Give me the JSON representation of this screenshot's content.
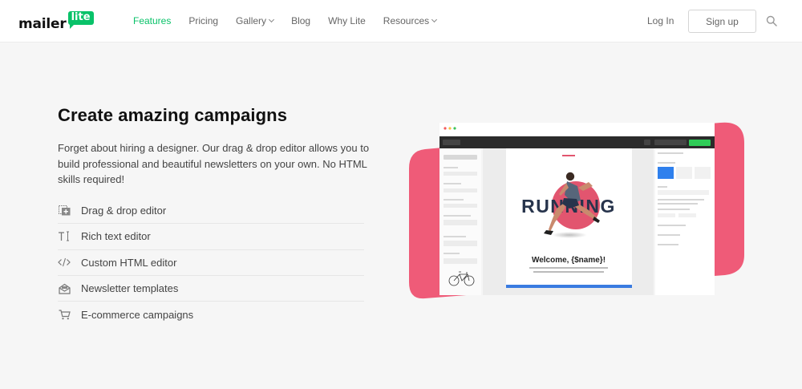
{
  "brand": {
    "logo_word": "mailer",
    "logo_bubble": "lite",
    "accent_color": "#09c269"
  },
  "nav": {
    "items": [
      {
        "label": "Features",
        "active": true,
        "dropdown": false
      },
      {
        "label": "Pricing",
        "active": false,
        "dropdown": false
      },
      {
        "label": "Gallery",
        "active": false,
        "dropdown": true
      },
      {
        "label": "Blog",
        "active": false,
        "dropdown": false
      },
      {
        "label": "Why Lite",
        "active": false,
        "dropdown": false
      },
      {
        "label": "Resources",
        "active": false,
        "dropdown": true
      }
    ],
    "login_label": "Log In",
    "signup_label": "Sign up",
    "search_icon": "search-icon"
  },
  "hero": {
    "title": "Create amazing campaigns",
    "description": "Forget about hiring a designer. Our drag & drop editor allows you to build professional and beautiful newsletters on your own. No HTML skills required!",
    "features": [
      {
        "label": "Drag & drop editor",
        "icon": "drag-drop-icon"
      },
      {
        "label": "Rich text editor",
        "icon": "text-cursor-icon"
      },
      {
        "label": "Custom HTML editor",
        "icon": "code-icon"
      },
      {
        "label": "Newsletter templates",
        "icon": "envelope-icon"
      },
      {
        "label": "E-commerce campaigns",
        "icon": "cart-icon"
      }
    ]
  },
  "editor_preview": {
    "headline_word": "RUNNING",
    "welcome_text": "Welcome, {$name}!",
    "blob_color": "#ef5b78"
  }
}
